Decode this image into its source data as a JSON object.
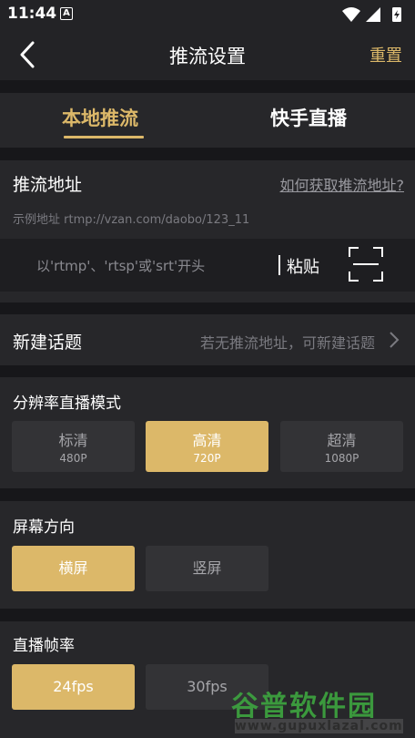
{
  "status_bar": {
    "time": "11:44",
    "notification_icon": "A",
    "icons": [
      "wifi-icon",
      "signal-icon",
      "battery-charging-icon"
    ]
  },
  "header": {
    "title": "推流设置",
    "reset_label": "重置",
    "back_icon": "chevron-left-icon"
  },
  "tabs": [
    {
      "label": "本地推流",
      "active": true
    },
    {
      "label": "快手直播",
      "active": false
    }
  ],
  "push_address": {
    "title": "推流地址",
    "help_link": "如何获取推流地址?",
    "example": "示例地址 rtmp://vzan.com/daobo/123_11",
    "input_placeholder": "以'rtmp'、'rtsp'或'srt'开头",
    "input_value": "",
    "paste_label": "粘贴",
    "scan_icon": "scan-icon"
  },
  "new_topic": {
    "label": "新建话题",
    "hint": "若无推流地址，可新建话题",
    "icon": "chevron-right-icon"
  },
  "resolution": {
    "title": "分辨率直播模式",
    "options": [
      {
        "label": "标清",
        "sub": "480P",
        "selected": false
      },
      {
        "label": "高清",
        "sub": "720P",
        "selected": true
      },
      {
        "label": "超清",
        "sub": "1080P",
        "selected": false
      }
    ]
  },
  "orientation": {
    "title": "屏幕方向",
    "options": [
      {
        "label": "横屏",
        "selected": true
      },
      {
        "label": "竖屏",
        "selected": false
      }
    ]
  },
  "frame_rate": {
    "title": "直播帧率",
    "options": [
      {
        "label": "24fps",
        "selected": true
      },
      {
        "label": "30fps",
        "selected": false
      }
    ]
  },
  "watermark": {
    "title": "谷普软件园",
    "url": "www.gupuxlazal.com"
  },
  "colors": {
    "accent": "#dcb869",
    "background": "#17171a",
    "panel": "#27272a",
    "option_off": "#333336"
  }
}
